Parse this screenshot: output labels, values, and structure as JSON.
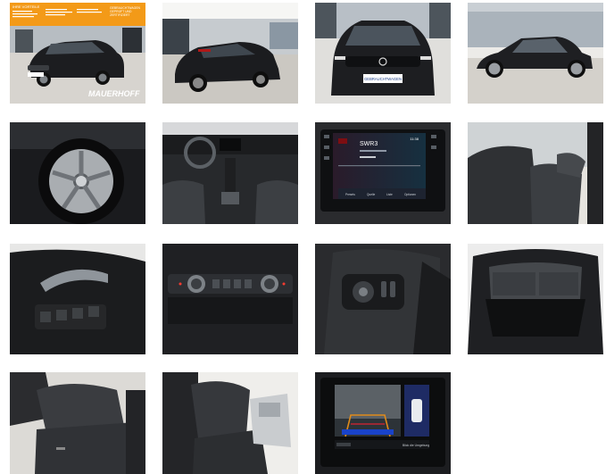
{
  "gallery": {
    "images": [
      {
        "id": "ext-front-left",
        "alt": "Front left exterior"
      },
      {
        "id": "ext-rear-left",
        "alt": "Rear left exterior"
      },
      {
        "id": "ext-front",
        "alt": "Front"
      },
      {
        "id": "ext-side",
        "alt": "Side profile"
      },
      {
        "id": "wheel",
        "alt": "Alloy wheel"
      },
      {
        "id": "dashboard",
        "alt": "Dashboard"
      },
      {
        "id": "infotainment",
        "alt": "Infotainment display"
      },
      {
        "id": "front-seats",
        "alt": "Front seats"
      },
      {
        "id": "door-panel",
        "alt": "Door panel controls"
      },
      {
        "id": "climate",
        "alt": "Climate controls"
      },
      {
        "id": "light-switch",
        "alt": "Light switch"
      },
      {
        "id": "trunk",
        "alt": "Trunk"
      },
      {
        "id": "rear-seats",
        "alt": "Rear seats"
      },
      {
        "id": "interior-side",
        "alt": "Interior side view"
      },
      {
        "id": "rear-camera",
        "alt": "Rear camera display"
      }
    ]
  },
  "banner": {
    "headline": "IHRE VORTEILE",
    "right_text": "GEBRAUCHTWAGEN GEPRÜFT UND ZERTIFIZIERT VON MAUERHOFF",
    "brand": "MAUERHOFF"
  },
  "plate": {
    "text": "GEBRAUCHTWAGEN"
  },
  "radio": {
    "station": "SWR3",
    "time": "11:38",
    "tab_presets": "Presets",
    "tab_quelle": "Quelle",
    "tab_liste": "Liste",
    "tab_optionen": "Optionen"
  },
  "camera": {
    "caption": "Blick die Umgebung"
  }
}
